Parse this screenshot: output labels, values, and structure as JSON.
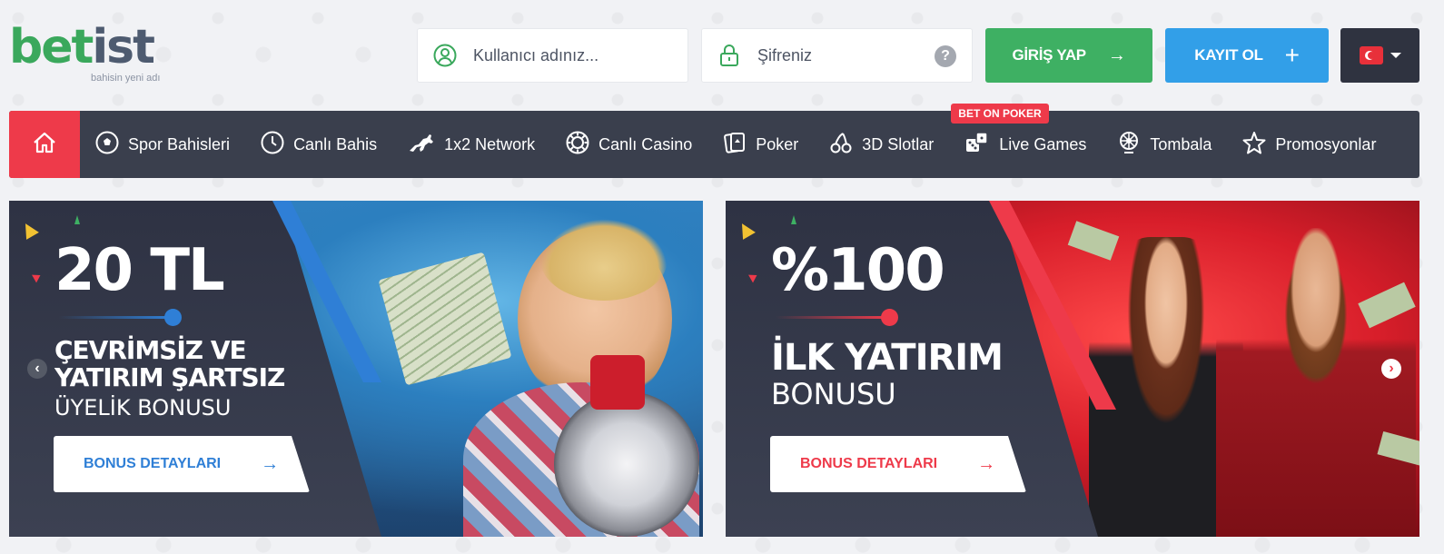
{
  "header": {
    "logo": {
      "part1": "bet",
      "part2": "ist",
      "tagline": "bahisin yeni adı"
    },
    "username": {
      "placeholder": "Kullanıcı adınız...",
      "icon": "user-icon"
    },
    "password": {
      "placeholder": "Şifreniz",
      "icon": "lock-icon",
      "help": "?"
    },
    "login_label": "GİRİŞ YAP",
    "register_label": "KAYIT OL",
    "language": {
      "flag": "turkey-flag-icon"
    }
  },
  "nav": {
    "home_icon": "home-icon",
    "items": [
      {
        "label": "Spor Bahisleri",
        "icon": "soccer-ball-icon"
      },
      {
        "label": "Canlı Bahis",
        "icon": "clock-icon"
      },
      {
        "label": "1x2 Network",
        "icon": "horse-icon"
      },
      {
        "label": "Canlı Casino",
        "icon": "casino-chip-icon"
      },
      {
        "label": "Poker",
        "icon": "cards-icon"
      },
      {
        "label": "3D Slotlar",
        "icon": "cherry-icon"
      },
      {
        "label": "Live Games",
        "icon": "dice-icon",
        "badge": "BET ON POKER"
      },
      {
        "label": "Tombala",
        "icon": "bingo-wheel-icon"
      },
      {
        "label": "Promosyonlar",
        "icon": "star-icon"
      }
    ]
  },
  "banners": [
    {
      "amount": "20 TL",
      "line1": "ÇEVRİMSİZ VE",
      "line2": "YATIRIM ŞARTSIZ",
      "subtitle": "ÜYELİK BONUSU",
      "button": "BONUS DETAYLARI",
      "accent": "#2f7fd6"
    },
    {
      "amount": "%100",
      "line1": "İLK YATIRIM",
      "subtitle": "BONUSU",
      "button": "BONUS DETAYLARI",
      "accent": "#ee3a4a"
    }
  ],
  "colors": {
    "green": "#3eb063",
    "blue": "#329fe8",
    "red": "#ee3a4a",
    "nav_bg": "#3a3f4d"
  }
}
